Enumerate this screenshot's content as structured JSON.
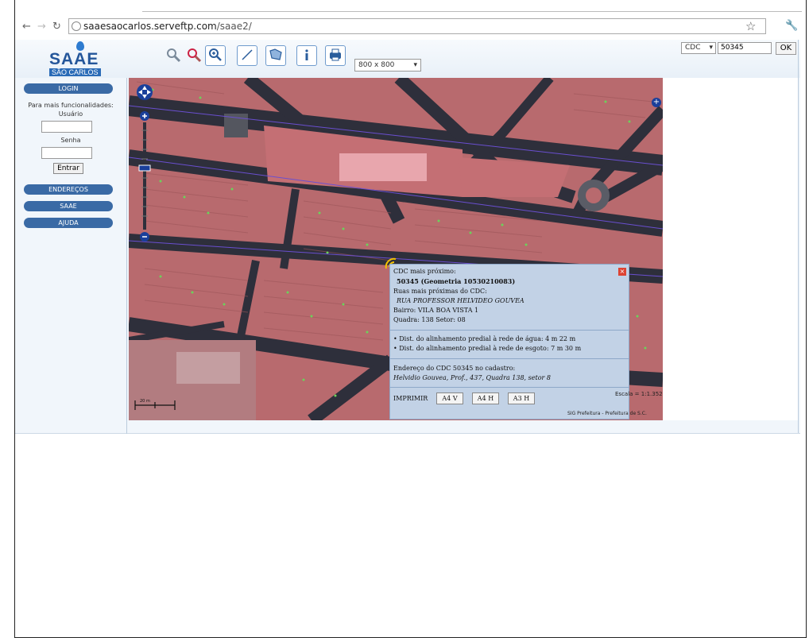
{
  "browser": {
    "url_host": "saaesaocarlos.serveftp.com",
    "url_path": "/saae2/",
    "nav_back": "←",
    "nav_forward": "→",
    "nav_reload": "↻",
    "star": "☆",
    "wrench": "🔧"
  },
  "logo": {
    "main": "SAAE",
    "sub": "SÃO CARLOS"
  },
  "toolbar": {
    "size_select": "800 x 800",
    "cdc_select": "CDC",
    "cdc_value": "50345",
    "ok_label": "OK"
  },
  "sidebar": {
    "login_label": "LOGIN",
    "intro_text": "Para mais funcionalidades:",
    "user_label": "Usuário",
    "password_label": "Senha",
    "enter_label": "Entrar",
    "addresses_label": "ENDEREÇOS",
    "saae_label": "SAAE",
    "help_label": "AJUDA"
  },
  "popup": {
    "title": "CDC mais próximo:",
    "cdc_line": "50345 (Geometria 10530210083)",
    "streets_label": "Ruas mais próximas do CDC:",
    "street_name": "RUA PROFESSOR HELVIDEO GOUVEA",
    "district_line": "Bairro:  VILA BOA VISTA 1",
    "quadra_line": "Quadra: 138   Setor: 08",
    "water_line": "Dist. do alinhamento predial à rede de água: 4 m  22 m",
    "sewer_line": "Dist. do alinhamento predial à rede de esgoto: 7 m  30 m",
    "address_label": "Endereço do CDC 50345 no cadastro:",
    "address_value": "Helvidio Gouvea, Prof., 437,   Quadra 138, setor 8",
    "print_label": "IMPRIMIR",
    "a4v_label": "A4 V",
    "a4h_label": "A4 H",
    "a3h_label": "A3 H"
  },
  "map": {
    "scale_label": "Escala = 1:1.352",
    "credit_label": "SIG Prefeitura - Prefeitura de S.C.",
    "scalebar_label": "20 m"
  },
  "colors": {
    "accent": "#3a6aa5",
    "map_block": "#b86a6e",
    "map_road": "#2e2f3b",
    "popup_bg": "#c2d2e6"
  }
}
